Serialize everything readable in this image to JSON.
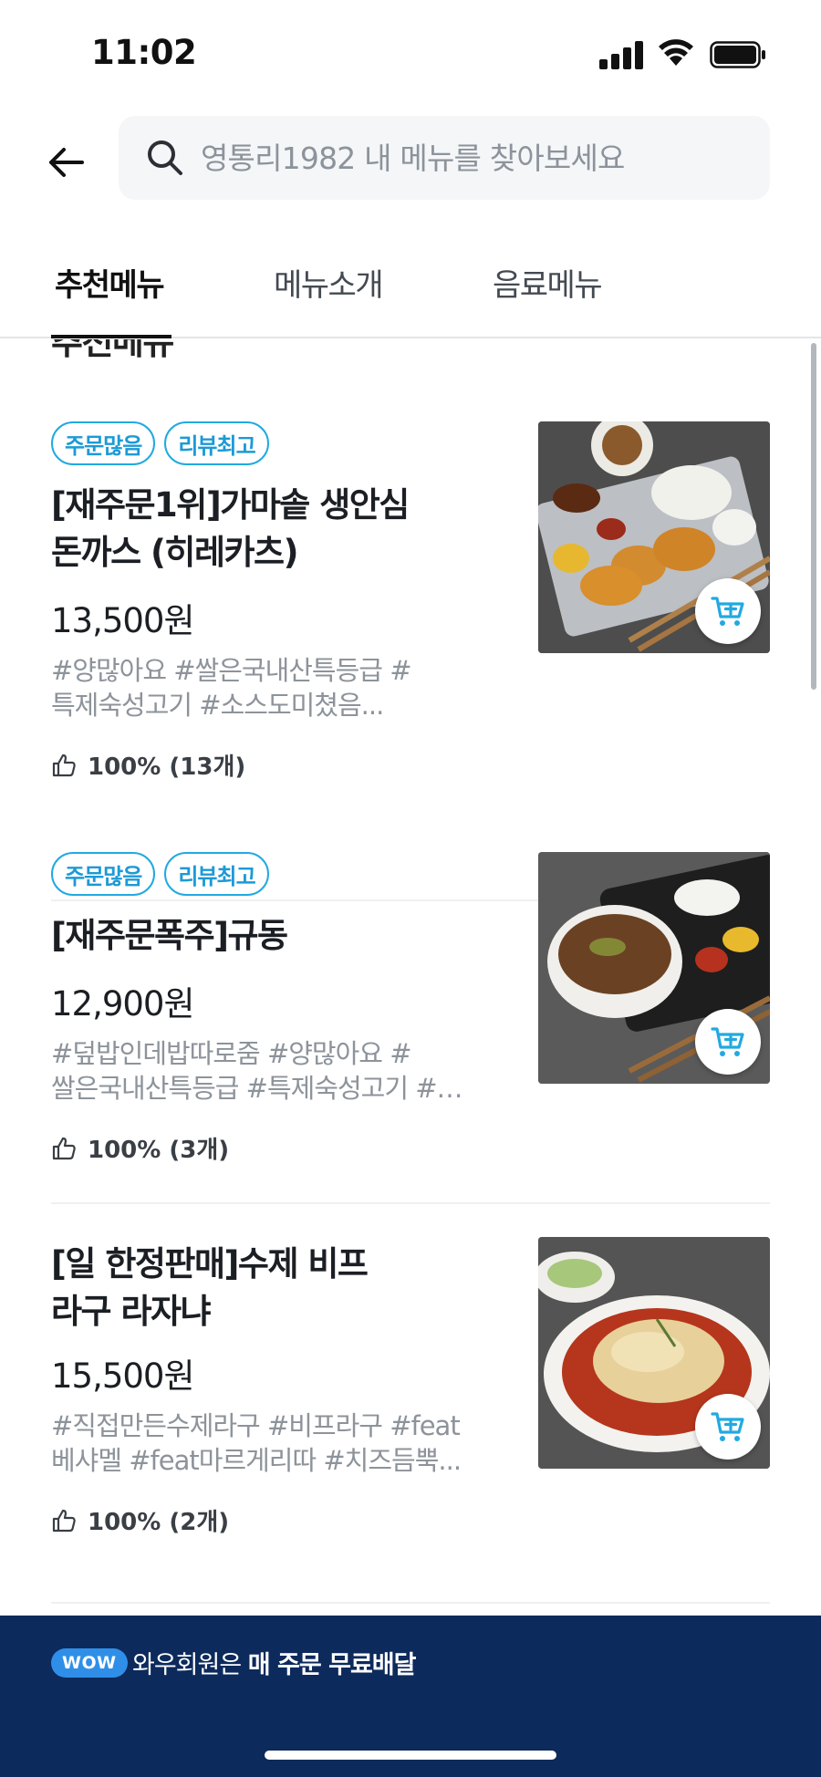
{
  "status_bar": {
    "time": "11:02"
  },
  "search": {
    "placeholder": "영통리1982 내 메뉴를 찾아보세요"
  },
  "tabs": [
    {
      "label": "추천메뉴",
      "active": true
    },
    {
      "label": "메뉴소개",
      "active": false
    },
    {
      "label": "음료메뉴",
      "active": false
    }
  ],
  "section": {
    "title": "추천메뉴"
  },
  "menu_items": [
    {
      "badges": [
        "주문많음",
        "리뷰최고"
      ],
      "name_line1": "[재주문1위]가마솥 생안심",
      "name_line2": "돈까스 (히레카츠)",
      "price": "13,500원",
      "tags_line1": "#양많아요 #쌀은국내산특등급 #",
      "tags_line2": "특제숙성고기 #소스도미쳤음...",
      "rating": "100% (13개)",
      "image": "tonkatsu-lunchbox"
    },
    {
      "badges": [
        "주문많음",
        "리뷰최고"
      ],
      "name_line1": "[재주문폭주]규동",
      "name_line2": "",
      "price": "12,900원",
      "tags_line1": "#덮밥인데밥따로줌 #양많아요 #",
      "tags_line2": "쌀은국내산특등급 #특제숙성고기 #…",
      "rating": "100% (3개)",
      "image": "gyudon-bowl"
    },
    {
      "badges": [],
      "name_line1": "[일 한정판매]수제 비프",
      "name_line2": "라구 라자냐",
      "price": "15,500원",
      "tags_line1": "#직접만든수제라구 #비프라구 #feat",
      "tags_line2": "베샤멜 #feat마르게리따 #치즈듬뿍...",
      "rating": "100% (2개)",
      "image": "beef-ragu-lasagna"
    }
  ],
  "banner": {
    "badge": "WOW",
    "text_prefix": "와우회원은 ",
    "text_bold": "매 주문 무료배달"
  },
  "colors": {
    "accent": "#22a9e1",
    "banner_bg": "#0c2a5c",
    "wow_badge": "#2f8fe8"
  }
}
